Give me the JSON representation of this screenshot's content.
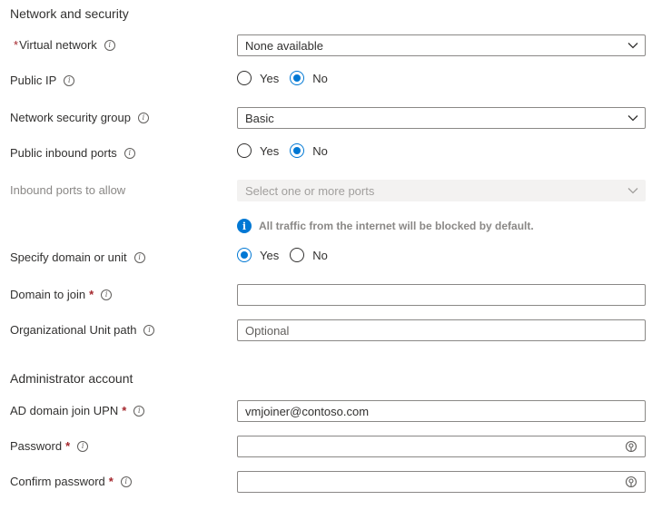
{
  "sections": {
    "network_title": "Network and security",
    "admin_title": "Administrator account"
  },
  "virtual_network": {
    "required_marker": "*",
    "label": "Virtual network",
    "value": "None available"
  },
  "public_ip": {
    "label": "Public IP",
    "yes": "Yes",
    "no": "No",
    "selected": "No"
  },
  "nsg": {
    "label": "Network security group",
    "value": "Basic"
  },
  "public_inbound": {
    "label": "Public inbound ports",
    "yes": "Yes",
    "no": "No",
    "selected": "No"
  },
  "inbound_allow": {
    "label": "Inbound ports to allow",
    "placeholder": "Select one or more ports"
  },
  "notice": {
    "icon_glyph": "i",
    "text": "All traffic from the internet will be blocked by default."
  },
  "specify_domain": {
    "label": "Specify domain or unit",
    "yes": "Yes",
    "no": "No",
    "selected": "Yes"
  },
  "domain_join": {
    "label": "Domain to join",
    "required_marker": "*",
    "value": ""
  },
  "ou_path": {
    "label": "Organizational Unit path",
    "placeholder": "Optional"
  },
  "upn": {
    "label": "AD domain join UPN",
    "required_marker": "*",
    "value": "vmjoiner@contoso.com"
  },
  "password": {
    "label": "Password",
    "required_marker": "*",
    "value": ""
  },
  "confirm_password": {
    "label": "Confirm password",
    "required_marker": "*",
    "value": ""
  },
  "info_glyph": "i",
  "colors": {
    "accent": "#0078d4",
    "required": "#a4262c",
    "border": "#8a8886"
  }
}
